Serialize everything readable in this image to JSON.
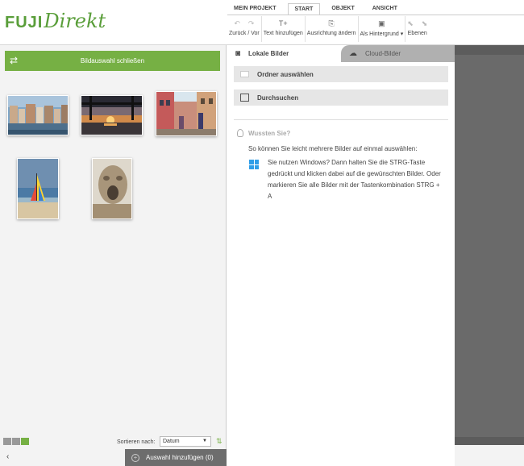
{
  "logo": {
    "brand1": "FUJI",
    "brand2": "Direkt"
  },
  "tabs": [
    "MEIN PROJEKT",
    "START",
    "OBJEKT",
    "ANSICHT"
  ],
  "toolbar": {
    "undo_redo": "Zurück / Vor",
    "add_text": "Text hinzufügen",
    "orientation": "Ausrichtung ändern",
    "as_background": "Als Hintergrund ▾",
    "layers": "Ebenen"
  },
  "left": {
    "close_button": "Bildauswahl schließen",
    "sort_label": "Sortieren nach:",
    "sort_value": "Datum",
    "add_selection": "Auswahl hinzufügen (0)"
  },
  "middle": {
    "tab_local": "Lokale Bilder",
    "tab_cloud": "Cloud-Bilder",
    "select_folder": "Ordner auswählen",
    "browse": "Durchsuchen",
    "tip_heading": "Wussten Sie?",
    "tip_intro": "So können Sie leicht mehrere Bilder auf einmal auswählen:",
    "tip_body": "Sie nutzen Windows? Dann halten Sie die STRG-Taste gedrückt und klicken dabei auf die gewünschten Bilder. Oder markieren Sie alle Bilder mit der Tastenkombination STRG + A"
  },
  "colors": {
    "accent": "#76b044",
    "windows_blue": "#2f9ee8"
  },
  "thumbnails": [
    "city-harbor",
    "sunset-bridge",
    "street-scene",
    "beach-sailboat",
    "sand-sculpture"
  ]
}
